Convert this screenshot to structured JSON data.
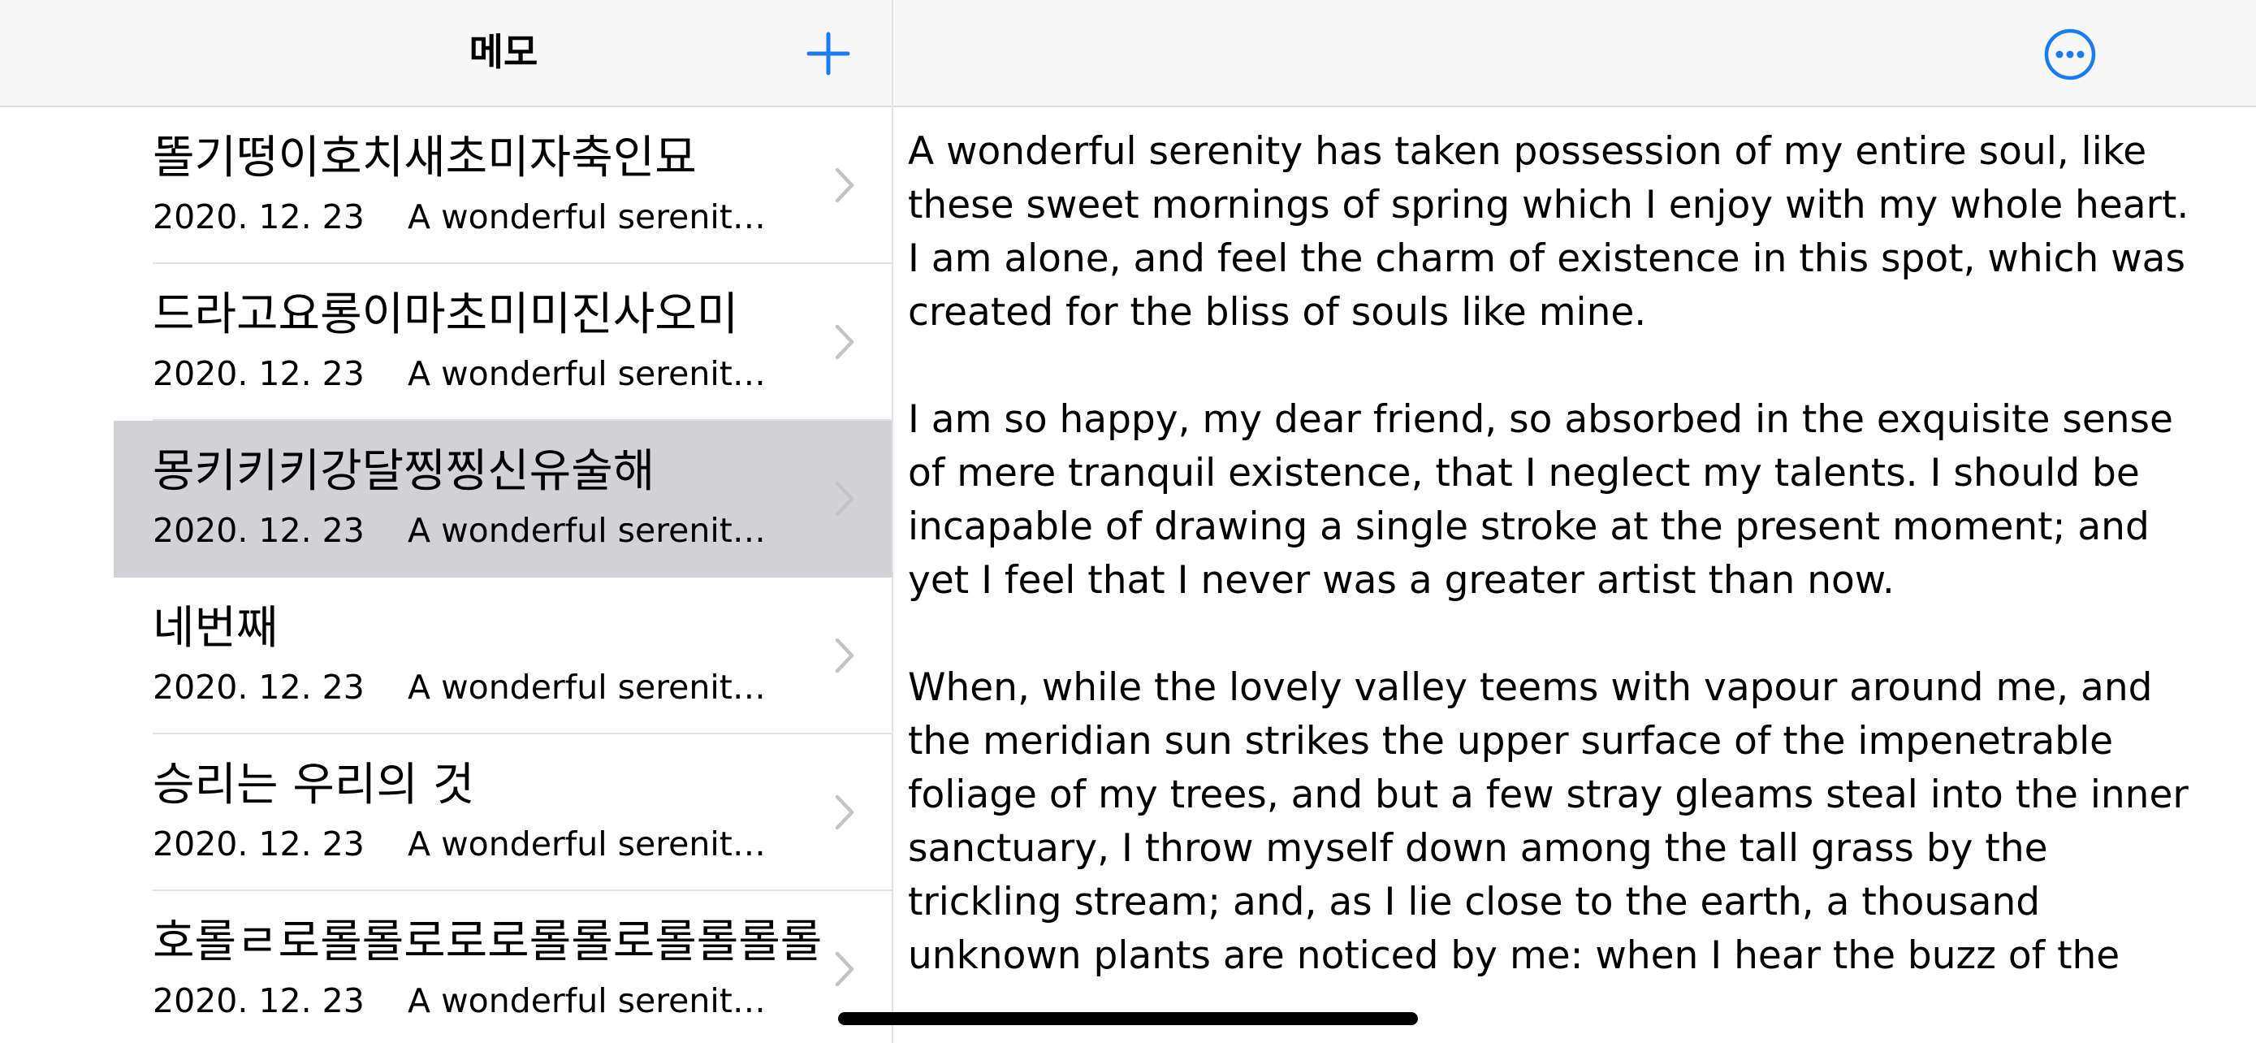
{
  "sidebar": {
    "title": "메모",
    "add_icon": "plus-icon",
    "accent_color": "#1a7cf5",
    "items": [
      {
        "title": "똘기떵이호치새초미자축인묘",
        "date": "2020. 12. 23",
        "preview": "A wonderful serenity has taken possession of my entire soul",
        "selected": false
      },
      {
        "title": "드라고요롱이마초미미진사오미",
        "date": "2020. 12. 23",
        "preview": "A wonderful serenity has taken possession of my entire soul",
        "selected": false
      },
      {
        "title": "몽키키키강달찡찡신유술해",
        "date": "2020. 12. 23",
        "preview": "A wonderful serenity has taken possession of my entire soul",
        "selected": true
      },
      {
        "title": "네번째",
        "date": "2020. 12. 23",
        "preview": "A wonderful serenity has taken possession of my entire soul",
        "selected": false
      },
      {
        "title": "승리는 우리의 것",
        "date": "2020. 12. 23",
        "preview": "A wonderful serenity has taken possession of my entire soul",
        "selected": false
      },
      {
        "title": "호롤ㄹ로롤롤로로로롤롤로롤롤롤롤",
        "date": "2020. 12. 23",
        "preview": "A wonderful serenity has taken possession of my entire soul",
        "selected": false
      }
    ]
  },
  "detail": {
    "more_icon": "ellipsis-circle-icon",
    "paragraphs": [
      "A wonderful serenity has taken possession of my entire soul, like these sweet mornings of spring which I enjoy with my whole heart. I am alone, and feel the charm of existence in this spot, which was created for the bliss of souls like mine.",
      "I am so happy, my dear friend, so absorbed in the exquisite sense of mere tranquil existence, that I neglect my talents. I should be incapable of drawing a single stroke at the present moment; and yet I feel that I never was a greater artist than now.",
      "When, while the lovely valley teems with vapour around me, and the meridian sun strikes the upper surface of the impenetrable foliage of my trees, and but a few stray gleams steal into the inner sanctuary, I throw myself down among the tall grass by the trickling stream; and, as I lie close to the earth, a thousand unknown plants are noticed by me: when I hear the buzz of the"
    ]
  },
  "colors": {
    "header_bg": "#f7f7f7",
    "selected_row": "#d1d1d6",
    "separator": "#e3e3e6",
    "chevron": "#c4c4c7"
  }
}
